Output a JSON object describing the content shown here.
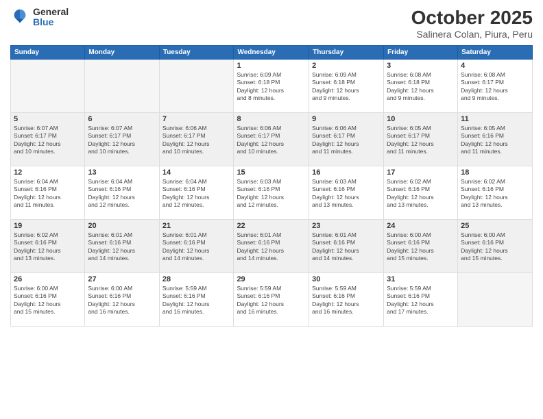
{
  "header": {
    "logo": {
      "general": "General",
      "blue": "Blue"
    },
    "title": "October 2025",
    "location": "Salinera Colan, Piura, Peru"
  },
  "days_of_week": [
    "Sunday",
    "Monday",
    "Tuesday",
    "Wednesday",
    "Thursday",
    "Friday",
    "Saturday"
  ],
  "weeks": [
    {
      "shaded": false,
      "days": [
        {
          "num": "",
          "info": ""
        },
        {
          "num": "",
          "info": ""
        },
        {
          "num": "",
          "info": ""
        },
        {
          "num": "1",
          "info": "Sunrise: 6:09 AM\nSunset: 6:18 PM\nDaylight: 12 hours\nand 8 minutes."
        },
        {
          "num": "2",
          "info": "Sunrise: 6:09 AM\nSunset: 6:18 PM\nDaylight: 12 hours\nand 9 minutes."
        },
        {
          "num": "3",
          "info": "Sunrise: 6:08 AM\nSunset: 6:18 PM\nDaylight: 12 hours\nand 9 minutes."
        },
        {
          "num": "4",
          "info": "Sunrise: 6:08 AM\nSunset: 6:17 PM\nDaylight: 12 hours\nand 9 minutes."
        }
      ]
    },
    {
      "shaded": true,
      "days": [
        {
          "num": "5",
          "info": "Sunrise: 6:07 AM\nSunset: 6:17 PM\nDaylight: 12 hours\nand 10 minutes."
        },
        {
          "num": "6",
          "info": "Sunrise: 6:07 AM\nSunset: 6:17 PM\nDaylight: 12 hours\nand 10 minutes."
        },
        {
          "num": "7",
          "info": "Sunrise: 6:06 AM\nSunset: 6:17 PM\nDaylight: 12 hours\nand 10 minutes."
        },
        {
          "num": "8",
          "info": "Sunrise: 6:06 AM\nSunset: 6:17 PM\nDaylight: 12 hours\nand 10 minutes."
        },
        {
          "num": "9",
          "info": "Sunrise: 6:06 AM\nSunset: 6:17 PM\nDaylight: 12 hours\nand 11 minutes."
        },
        {
          "num": "10",
          "info": "Sunrise: 6:05 AM\nSunset: 6:17 PM\nDaylight: 12 hours\nand 11 minutes."
        },
        {
          "num": "11",
          "info": "Sunrise: 6:05 AM\nSunset: 6:16 PM\nDaylight: 12 hours\nand 11 minutes."
        }
      ]
    },
    {
      "shaded": false,
      "days": [
        {
          "num": "12",
          "info": "Sunrise: 6:04 AM\nSunset: 6:16 PM\nDaylight: 12 hours\nand 11 minutes."
        },
        {
          "num": "13",
          "info": "Sunrise: 6:04 AM\nSunset: 6:16 PM\nDaylight: 12 hours\nand 12 minutes."
        },
        {
          "num": "14",
          "info": "Sunrise: 6:04 AM\nSunset: 6:16 PM\nDaylight: 12 hours\nand 12 minutes."
        },
        {
          "num": "15",
          "info": "Sunrise: 6:03 AM\nSunset: 6:16 PM\nDaylight: 12 hours\nand 12 minutes."
        },
        {
          "num": "16",
          "info": "Sunrise: 6:03 AM\nSunset: 6:16 PM\nDaylight: 12 hours\nand 13 minutes."
        },
        {
          "num": "17",
          "info": "Sunrise: 6:02 AM\nSunset: 6:16 PM\nDaylight: 12 hours\nand 13 minutes."
        },
        {
          "num": "18",
          "info": "Sunrise: 6:02 AM\nSunset: 6:16 PM\nDaylight: 12 hours\nand 13 minutes."
        }
      ]
    },
    {
      "shaded": true,
      "days": [
        {
          "num": "19",
          "info": "Sunrise: 6:02 AM\nSunset: 6:16 PM\nDaylight: 12 hours\nand 13 minutes."
        },
        {
          "num": "20",
          "info": "Sunrise: 6:01 AM\nSunset: 6:16 PM\nDaylight: 12 hours\nand 14 minutes."
        },
        {
          "num": "21",
          "info": "Sunrise: 6:01 AM\nSunset: 6:16 PM\nDaylight: 12 hours\nand 14 minutes."
        },
        {
          "num": "22",
          "info": "Sunrise: 6:01 AM\nSunset: 6:16 PM\nDaylight: 12 hours\nand 14 minutes."
        },
        {
          "num": "23",
          "info": "Sunrise: 6:01 AM\nSunset: 6:16 PM\nDaylight: 12 hours\nand 14 minutes."
        },
        {
          "num": "24",
          "info": "Sunrise: 6:00 AM\nSunset: 6:16 PM\nDaylight: 12 hours\nand 15 minutes."
        },
        {
          "num": "25",
          "info": "Sunrise: 6:00 AM\nSunset: 6:16 PM\nDaylight: 12 hours\nand 15 minutes."
        }
      ]
    },
    {
      "shaded": false,
      "days": [
        {
          "num": "26",
          "info": "Sunrise: 6:00 AM\nSunset: 6:16 PM\nDaylight: 12 hours\nand 15 minutes."
        },
        {
          "num": "27",
          "info": "Sunrise: 6:00 AM\nSunset: 6:16 PM\nDaylight: 12 hours\nand 16 minutes."
        },
        {
          "num": "28",
          "info": "Sunrise: 5:59 AM\nSunset: 6:16 PM\nDaylight: 12 hours\nand 16 minutes."
        },
        {
          "num": "29",
          "info": "Sunrise: 5:59 AM\nSunset: 6:16 PM\nDaylight: 12 hours\nand 16 minutes."
        },
        {
          "num": "30",
          "info": "Sunrise: 5:59 AM\nSunset: 6:16 PM\nDaylight: 12 hours\nand 16 minutes."
        },
        {
          "num": "31",
          "info": "Sunrise: 5:59 AM\nSunset: 6:16 PM\nDaylight: 12 hours\nand 17 minutes."
        },
        {
          "num": "",
          "info": ""
        }
      ]
    }
  ]
}
